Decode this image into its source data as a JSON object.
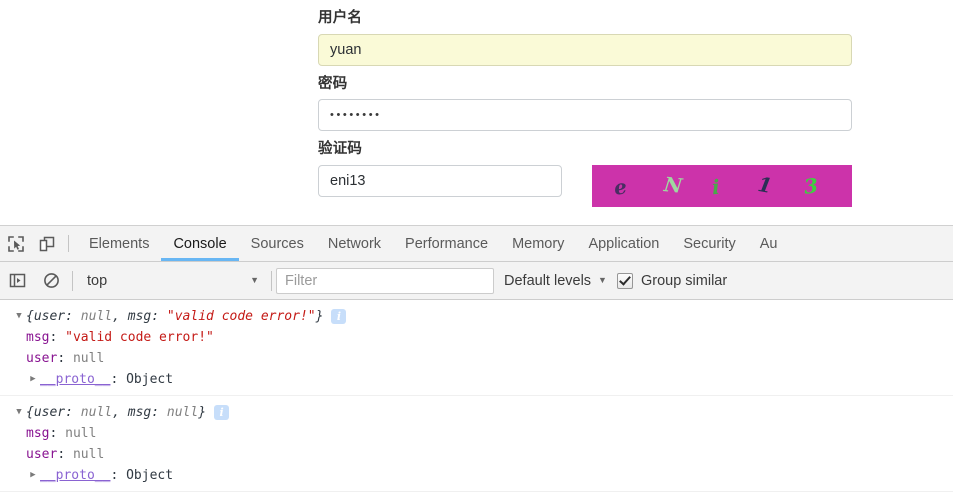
{
  "page": {
    "form": {
      "username": {
        "label": "用户名",
        "value": "yuan",
        "placeholder": ""
      },
      "password": {
        "label": "密码",
        "value": "••••••••",
        "dot_count": 8,
        "placeholder": ""
      },
      "captcha": {
        "label": "验证码",
        "value": "eni13",
        "placeholder": "",
        "image_background": "#cc33aa",
        "characters": [
          {
            "char": "e",
            "color": "#4a2d63"
          },
          {
            "char": "N",
            "color": "#9fd8a0"
          },
          {
            "char": "i",
            "color": "#4aa84a"
          },
          {
            "char": "1",
            "color": "#2b2f55"
          },
          {
            "char": "3",
            "color": "#3fd13f"
          }
        ]
      }
    }
  },
  "devtools": {
    "tabs": [
      {
        "label": "Elements",
        "active": false
      },
      {
        "label": "Console",
        "active": true
      },
      {
        "label": "Sources",
        "active": false
      },
      {
        "label": "Network",
        "active": false
      },
      {
        "label": "Performance",
        "active": false
      },
      {
        "label": "Memory",
        "active": false
      },
      {
        "label": "Application",
        "active": false
      },
      {
        "label": "Security",
        "active": false
      },
      {
        "label": "Au",
        "active": false
      }
    ],
    "active_tab_underline_color": "#68b6f3",
    "icons": {
      "inspect": "inspect-element-icon",
      "device": "device-toolbar-icon",
      "sidebar": "console-sidebar-icon",
      "clear": "clear-console-icon"
    },
    "toolbar": {
      "context": "top",
      "context_caret": "▼",
      "filter_placeholder": "Filter",
      "filter_value": "",
      "levels_label": "Default levels",
      "levels_caret": "▼",
      "group_similar_label": "Group similar",
      "group_similar_checked": true
    },
    "console_logs": [
      {
        "expanded": true,
        "preview_parts": [
          {
            "text": "{",
            "type": "token"
          },
          {
            "text": "user",
            "type": "token"
          },
          {
            "text": ": ",
            "type": "token"
          },
          {
            "text": "null",
            "type": "null"
          },
          {
            "text": ", ",
            "type": "token"
          },
          {
            "text": "msg",
            "type": "token"
          },
          {
            "text": ": ",
            "type": "token"
          },
          {
            "text": "\"valid code error!\"",
            "type": "string"
          },
          {
            "text": "}",
            "type": "token"
          }
        ],
        "has_info_badge": true,
        "info_badge_glyph": "i",
        "properties": [
          {
            "key": "msg",
            "value": "\"valid code error!\"",
            "type": "string"
          },
          {
            "key": "user",
            "value": "null",
            "type": "null"
          }
        ],
        "proto": {
          "key": "__proto__",
          "value": "Object"
        }
      },
      {
        "expanded": true,
        "preview_parts": [
          {
            "text": "{",
            "type": "token"
          },
          {
            "text": "user",
            "type": "token"
          },
          {
            "text": ": ",
            "type": "token"
          },
          {
            "text": "null",
            "type": "null"
          },
          {
            "text": ", ",
            "type": "token"
          },
          {
            "text": "msg",
            "type": "token"
          },
          {
            "text": ": ",
            "type": "token"
          },
          {
            "text": "null",
            "type": "null"
          },
          {
            "text": "}",
            "type": "token"
          }
        ],
        "has_info_badge": true,
        "info_badge_glyph": "i",
        "properties": [
          {
            "key": "msg",
            "value": "null",
            "type": "null"
          },
          {
            "key": "user",
            "value": "null",
            "type": "null"
          }
        ],
        "proto": {
          "key": "__proto__",
          "value": "Object"
        }
      }
    ]
  }
}
